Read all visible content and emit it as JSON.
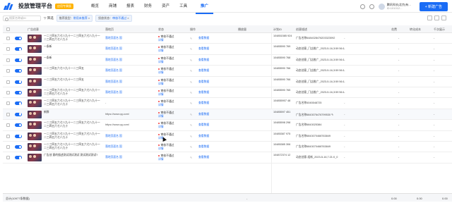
{
  "header": {
    "brand": "投放管理平台",
    "badge": "应用专属版",
    "nav": [
      "概览",
      "推广",
      "商铺",
      "报表",
      "财务",
      "资产",
      "工具"
    ],
    "active_nav": 1,
    "account_name": "腾讯科技(北京)有...",
    "account_sub": "ID:101012...",
    "new_ad_button": "+ 新建广告"
  },
  "filters": {
    "search_placeholder": "搜索名称或ID",
    "filter_label": "筛选",
    "chip1_key": "推荐类型：",
    "chip1_val": "常用未推荐",
    "chip2_key": "投放状态：",
    "chip2_val": "审核不通过"
  },
  "table": {
    "headers": [
      "广告创意",
      "落地页",
      "状态",
      "操作",
      "播放量",
      "计划ID",
      "创意描述",
      "花费",
      "转化成本",
      "千次展示"
    ],
    "rows": [
      {
        "name": "一二三四五六七八九十一二三四五六七八九十一二三四五六七八九十",
        "link": "落地页面名 国",
        "status": "审核不通过",
        "status_sub": "详情",
        "act": "查看数据",
        "id": "104851585 924",
        "desc": "广告名称6484028476203323092",
        "ev": "-",
        "v1": "-",
        "v2": "-"
      },
      {
        "name": "一条新",
        "link": "落地页面名 国",
        "status": "审核不通过",
        "status_sub": "详情",
        "act": "查看数据",
        "id": "10485590 769",
        "desc": "动态创意_门店推广_2023-5-16,3:59 56:1",
        "ev": "-",
        "v1": "-",
        "v2": "-"
      },
      {
        "name": "一条新",
        "link": "落地页面名 国",
        "status": "审核不通过",
        "status_sub": "详情",
        "act": "查看数据",
        "id": "10485590 768",
        "desc": "动态创意_门店推广_2023-5-16,3:59 56:1",
        "ev": "-",
        "v1": "-",
        "v2": "-"
      },
      {
        "name": "一二三四五六七八九十一二三四五",
        "link": "落地页面名 国",
        "status": "审核不通过",
        "status_sub": "详情",
        "act": "查看数据",
        "id": "10485590 766",
        "desc": "动态创意_门店推广_2023-5-16,3:59 56:1",
        "ev": "-",
        "v1": "-",
        "v2": "-"
      },
      {
        "name": "一二三四五六七八九十一二三四五",
        "link": "落地页面名 国",
        "status": "审核不通过",
        "status_sub": "详情",
        "act": "查看数据",
        "id": "10485590 766",
        "desc": "动态创意_门店推广_2023-5-16,3:59 56:1",
        "ev": "-",
        "v1": "-",
        "v2": "-"
      },
      {
        "name": "一二三四五六七八九十一二三四五六七八九十一二三四五六七八九十",
        "link": "落地页面名 国",
        "status": "审核不通过",
        "status_sub": "详情",
        "act": "查看数据",
        "id": "10485590 765",
        "desc": "动态创意_门店推广_2023-5-16,3:59 56:1",
        "ev": "-",
        "v1": "-",
        "v2": "-"
      },
      {
        "name": "一二三四五六七八九十一二三四五六七八九十一二三四五六七八九十",
        "link": "-",
        "status": "审核不通过",
        "status_sub": "详情",
        "act": "查看数据",
        "id": "104855907 48",
        "desc": "广告名称4045548725",
        "ev": "-",
        "v1": "-",
        "v2": "-"
      },
      {
        "name": "新鲜",
        "link": "https://www.qq.com/",
        "status": "审核不通过",
        "status_sub": "详情",
        "act": "查看数据",
        "id": "10485597 451",
        "desc": "广告名称6843076476799530 ✎",
        "ev": "-",
        "v1": "-",
        "v2": "-"
      },
      {
        "name": "一二三四五六七八九十一二三四五六七八九十一二三四五六七八九十",
        "link": "https://www.qq.com/",
        "status": "审核不通过",
        "status_sub": "详情",
        "act": "查看数据",
        "id": "10485598 298",
        "desc": "广告名称6843025384",
        "ev": "-",
        "v1": "-",
        "v2": "-"
      },
      {
        "name": "一二三四五六七八九十一二三四五六七八九十一二三四五六七八九十",
        "link": "落地页面名 国",
        "status": "审核不通过",
        "status_sub": "详情",
        "act": "查看数据",
        "id": "10485387 975",
        "desc": "广告名称6843070468763849",
        "ev": "-",
        "v1": "-",
        "v2": "-"
      },
      {
        "name": "一二三四五六七八九十一二三四五六七八九十一二三四五六七八九十",
        "link": "落地页面名 国",
        "status": "审核不通过",
        "status_sub": "详情",
        "act": "查看数据",
        "id": "10485385 306",
        "desc": "广告名称6843070468763849",
        "ev": "-",
        "v1": "-",
        "v2": "-"
      },
      {
        "name": "广告创 意的描述测试测试测试 测试测试测试?",
        "link": "落地页面名 国",
        "status": "审核不通过",
        "status_sub": "详情",
        "act": "查看数据",
        "id": "104872374 12",
        "desc": "动态创意-组新_2023-5-16,7:21:0_0",
        "ev": "-",
        "v1": "-",
        "v2": "-"
      }
    ]
  },
  "footer": {
    "total": "总计(10977条数据)",
    "c1": "-",
    "c2": "0.00",
    "c3": "0.00",
    "c4": "0.00"
  }
}
